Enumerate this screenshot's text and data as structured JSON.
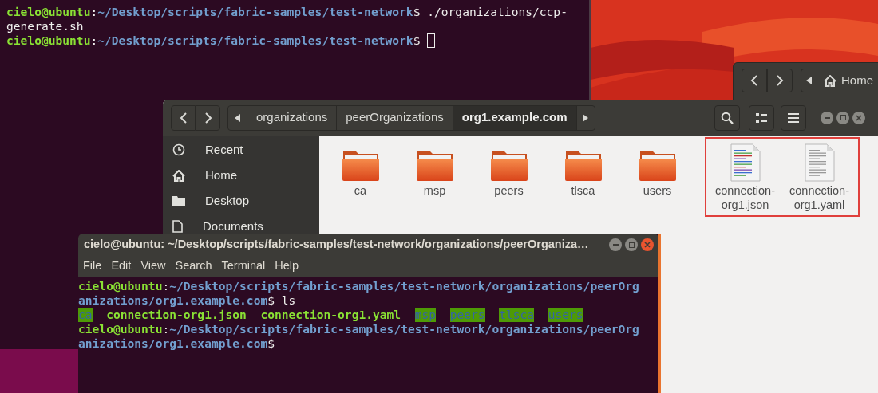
{
  "back_terminal": {
    "lines": [
      [
        {
          "kind": "user",
          "text": "cielo@ubuntu"
        },
        {
          "kind": "text",
          "text": ":"
        },
        {
          "kind": "path",
          "text": "~/Desktop/scripts/fabric-samples/test-network"
        },
        {
          "kind": "text",
          "text": "$ ./organizations/ccp-"
        }
      ],
      [
        {
          "kind": "text",
          "text": "generate.sh"
        }
      ],
      [
        {
          "kind": "user",
          "text": "cielo@ubuntu"
        },
        {
          "kind": "text",
          "text": ":"
        },
        {
          "kind": "path",
          "text": "~/Desktop/scripts/fabric-samples/test-network"
        },
        {
          "kind": "text",
          "text": "$ "
        }
      ]
    ],
    "cursor": true
  },
  "back_files_window": {
    "path": [
      {
        "label": "Home"
      }
    ]
  },
  "files_window": {
    "path": [
      {
        "label": "organizations",
        "selected": false
      },
      {
        "label": "peerOrganizations",
        "selected": false
      },
      {
        "label": "org1.example.com",
        "selected": true
      }
    ],
    "sidebar": [
      {
        "label": "Recent",
        "kind": "recent"
      },
      {
        "label": "Home",
        "kind": "home"
      },
      {
        "label": "Desktop",
        "kind": "desktop"
      },
      {
        "label": "Documents",
        "kind": "documents"
      }
    ],
    "items": [
      {
        "name": "ca",
        "kind": "folder",
        "boxed": false
      },
      {
        "name": "msp",
        "kind": "folder",
        "boxed": false
      },
      {
        "name": "peers",
        "kind": "folder",
        "boxed": false
      },
      {
        "name": "tlsca",
        "kind": "folder",
        "boxed": false
      },
      {
        "name": "users",
        "kind": "folder",
        "boxed": false
      },
      {
        "name": "connection-\norg1.json",
        "kind": "code",
        "boxed": true
      },
      {
        "name": "connection-\norg1.yaml",
        "kind": "text",
        "boxed": true
      }
    ]
  },
  "front_terminal": {
    "title": "cielo@ubuntu: ~/Desktop/scripts/fabric-samples/test-network/organizations/peerOrganiza…",
    "menu": [
      "File",
      "Edit",
      "View",
      "Search",
      "Terminal",
      "Help"
    ],
    "lines": [
      {
        "kind": "prompt",
        "segments": [
          {
            "kind": "user",
            "text": "cielo@ubuntu"
          },
          {
            "kind": "text",
            "text": ":"
          },
          {
            "kind": "path",
            "text": "~/Desktop/scripts/fabric-samples/test-network/organizations/peerOrg"
          }
        ]
      },
      {
        "kind": "prompt",
        "segments": [
          {
            "kind": "path",
            "text": "anizations/org1.example.com"
          },
          {
            "kind": "text",
            "text": "$ ls"
          }
        ]
      },
      {
        "kind": "listing",
        "entries": [
          {
            "name": "ca",
            "kind": "dir"
          },
          {
            "name": "connection-org1.json",
            "kind": "file"
          },
          {
            "name": "connection-org1.yaml",
            "kind": "file"
          },
          {
            "name": "msp",
            "kind": "dir"
          },
          {
            "name": "peers",
            "kind": "dir"
          },
          {
            "name": "tlsca",
            "kind": "dir"
          },
          {
            "name": "users",
            "kind": "dir"
          }
        ]
      },
      {
        "kind": "prompt",
        "segments": [
          {
            "kind": "user",
            "text": "cielo@ubuntu"
          },
          {
            "kind": "text",
            "text": ":"
          },
          {
            "kind": "path",
            "text": "~/Desktop/scripts/fabric-samples/test-network/organizations/peerOrg"
          }
        ]
      },
      {
        "kind": "prompt",
        "segments": [
          {
            "kind": "path",
            "text": "anizations/org1.example.com"
          },
          {
            "kind": "text",
            "text": "$"
          }
        ]
      }
    ]
  }
}
